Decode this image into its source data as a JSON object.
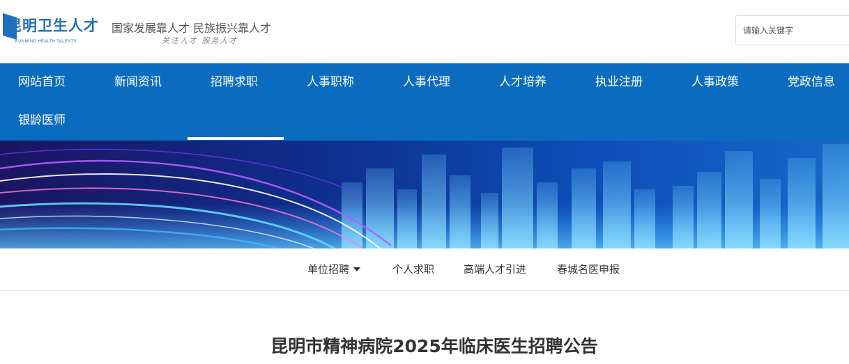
{
  "header": {
    "logo_text": "昆明卫生人才",
    "logo_sub": "KUNMING HEALTH TALENTS",
    "slogan": "国家发展靠人才 民族振兴靠人才",
    "slogan_sub": "关注人才 服务人才",
    "search_placeholder": "请输入关键字"
  },
  "nav": {
    "active_index": 2,
    "items": [
      {
        "label": "网站首页"
      },
      {
        "label": "新闻资讯"
      },
      {
        "label": "招聘求职"
      },
      {
        "label": "人事职称"
      },
      {
        "label": "人事代理"
      },
      {
        "label": "人才培养"
      },
      {
        "label": "执业注册"
      },
      {
        "label": "人事政策"
      },
      {
        "label": "党政信息"
      },
      {
        "label": "银龄医师"
      }
    ]
  },
  "subnav": {
    "items": [
      {
        "label": "单位招聘",
        "has_dropdown": true
      },
      {
        "label": "个人求职"
      },
      {
        "label": "高端人才引进"
      },
      {
        "label": "春城名医申报"
      }
    ]
  },
  "article": {
    "title": "昆明市精神病院2025年临床医生招聘公告"
  },
  "colors": {
    "nav_bg": "#0b6cbf",
    "brand": "#1f6fbf"
  }
}
